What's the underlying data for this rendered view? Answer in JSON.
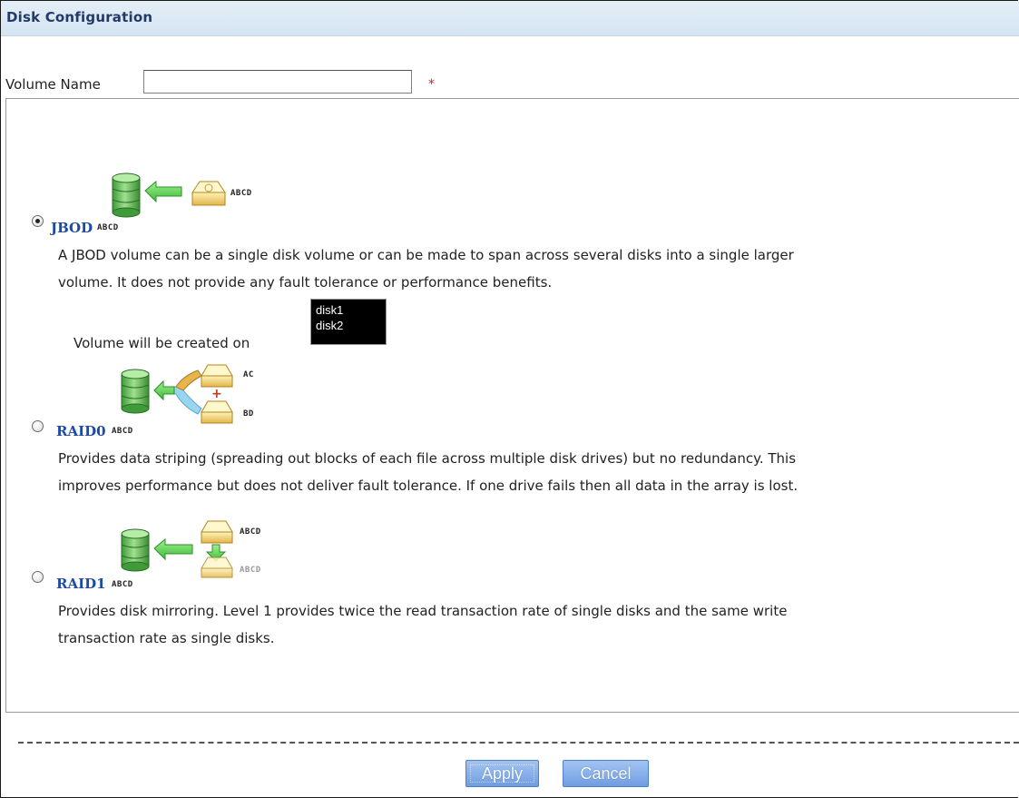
{
  "header": {
    "title": "Disk Configuration"
  },
  "volume": {
    "label": "Volume Name",
    "value": "",
    "required_marker": "*"
  },
  "options": [
    {
      "id": "jbod",
      "title": "JBOD",
      "selected": true,
      "icon_tags": {
        "target": "ABCD",
        "source": "ABCD"
      },
      "description": [
        "A JBOD volume can be a single disk volume or can be made to span across several disks into a single larger",
        "volume. It does not provide any fault tolerance or performance benefits."
      ],
      "created_on_label": "Volume will be created on",
      "disks": [
        "disk1",
        "disk2"
      ]
    },
    {
      "id": "raid0",
      "title": "RAID0",
      "selected": false,
      "icon_tags": {
        "target": "ABCD",
        "source_a": "AC",
        "source_b": "BD"
      },
      "description": [
        "Provides data striping (spreading out blocks of each file across multiple disk drives) but no redundancy. This",
        "improves performance but does not deliver fault tolerance. If one drive fails then all data in the array is lost."
      ]
    },
    {
      "id": "raid1",
      "title": "RAID1",
      "selected": false,
      "icon_tags": {
        "target": "ABCD",
        "source_a": "ABCD",
        "source_b": "ABCD"
      },
      "description": [
        "Provides disk mirroring. Level 1 provides twice the read transaction rate of single disks and the same write",
        "transaction rate as single disks."
      ]
    }
  ],
  "buttons": {
    "apply": "Apply",
    "cancel": "Cancel"
  },
  "colors": {
    "header_bg": "#d9e6f3",
    "title": "#223a66",
    "option_title": "#1d4aa8",
    "required": "#cc2222",
    "button": "#7fa8e6"
  }
}
